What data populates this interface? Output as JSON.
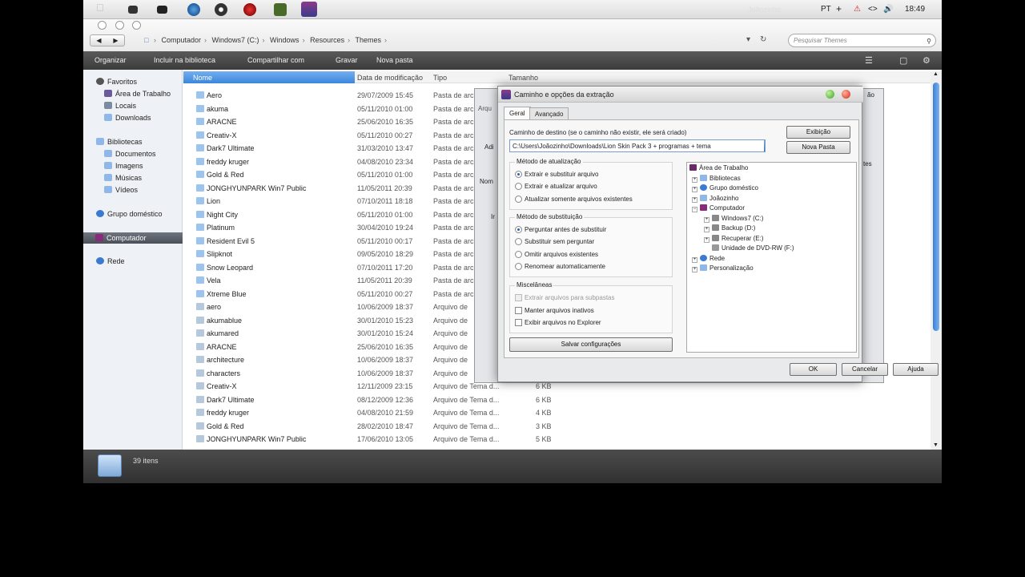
{
  "taskbar": {
    "user": "Joãozinho",
    "lang": "PT",
    "clock": "18:49"
  },
  "nav": {
    "breadcrumbs": [
      "Computador",
      "Windows7 (C:)",
      "Windows",
      "Resources",
      "Themes"
    ],
    "search_placeholder": "Pesquisar Themes"
  },
  "toolbar": {
    "organizar": "Organizar",
    "incluir": "Incluir na biblioteca",
    "compartilhar": "Compartilhar com",
    "gravar": "Gravar",
    "nova_pasta": "Nova pasta"
  },
  "sidebar": {
    "favoritos": "Favoritos",
    "area_trabalho": "Área de Trabalho",
    "locais": "Locais",
    "downloads": "Downloads",
    "bibliotecas": "Bibliotecas",
    "documentos": "Documentos",
    "imagens": "Imagens",
    "musicas": "Músicas",
    "videos": "Vídeos",
    "grupo": "Grupo doméstico",
    "computador": "Computador",
    "rede": "Rede"
  },
  "columns": {
    "nome": "Nome",
    "data": "Data de modificação",
    "tipo": "Tipo",
    "tamanho": "Tamanho"
  },
  "files": [
    {
      "name": "Aero",
      "date": "29/07/2009 15:45",
      "type": "Pasta de arc",
      "size": ""
    },
    {
      "name": "akuma",
      "date": "05/11/2010 01:00",
      "type": "Pasta de arc",
      "size": ""
    },
    {
      "name": "ARACNE",
      "date": "25/06/2010 16:35",
      "type": "Pasta de arc",
      "size": ""
    },
    {
      "name": "Creativ-X",
      "date": "05/11/2010 00:27",
      "type": "Pasta de arc",
      "size": ""
    },
    {
      "name": "Dark7 Ultimate",
      "date": "31/03/2010 13:47",
      "type": "Pasta de arc",
      "size": ""
    },
    {
      "name": "freddy kruger",
      "date": "04/08/2010 23:34",
      "type": "Pasta de arc",
      "size": ""
    },
    {
      "name": "Gold & Red",
      "date": "05/11/2010 01:00",
      "type": "Pasta de arc",
      "size": ""
    },
    {
      "name": "JONGHYUNPARK Win7 Public",
      "date": "11/05/2011 20:39",
      "type": "Pasta de arc",
      "size": ""
    },
    {
      "name": "Lion",
      "date": "07/10/2011 18:18",
      "type": "Pasta de arc",
      "size": ""
    },
    {
      "name": "Night City",
      "date": "05/11/2010 01:00",
      "type": "Pasta de arc",
      "size": ""
    },
    {
      "name": "Platinum",
      "date": "30/04/2010 19:24",
      "type": "Pasta de arc",
      "size": ""
    },
    {
      "name": "Resident Evil 5",
      "date": "05/11/2010 00:17",
      "type": "Pasta de arc",
      "size": ""
    },
    {
      "name": "Slipknot",
      "date": "09/05/2010 18:29",
      "type": "Pasta de arc",
      "size": ""
    },
    {
      "name": "Snow Leopard",
      "date": "07/10/2011 17:20",
      "type": "Pasta de arc",
      "size": ""
    },
    {
      "name": "Vela",
      "date": "11/05/2011 20:39",
      "type": "Pasta de arc",
      "size": ""
    },
    {
      "name": "Xtreme Blue",
      "date": "05/11/2010 00:27",
      "type": "Pasta de arc",
      "size": ""
    },
    {
      "name": "aero",
      "date": "10/06/2009 18:37",
      "type": "Arquivo de",
      "size": ""
    },
    {
      "name": "akumablue",
      "date": "30/01/2010 15:23",
      "type": "Arquivo de",
      "size": ""
    },
    {
      "name": "akumared",
      "date": "30/01/2010 15:24",
      "type": "Arquivo de",
      "size": ""
    },
    {
      "name": "ARACNE",
      "date": "25/06/2010 16:35",
      "type": "Arquivo de",
      "size": ""
    },
    {
      "name": "architecture",
      "date": "10/06/2009 18:37",
      "type": "Arquivo de",
      "size": ""
    },
    {
      "name": "characters",
      "date": "10/06/2009 18:37",
      "type": "Arquivo de",
      "size": ""
    },
    {
      "name": "Creativ-X",
      "date": "12/11/2009 23:15",
      "type": "Arquivo de Tema d...",
      "size": "6 KB"
    },
    {
      "name": "Dark7 Ultimate",
      "date": "08/12/2009 12:36",
      "type": "Arquivo de Tema d...",
      "size": "6 KB"
    },
    {
      "name": "freddy kruger",
      "date": "04/08/2010 21:59",
      "type": "Arquivo de Tema d...",
      "size": "4 KB"
    },
    {
      "name": "Gold & Red",
      "date": "28/02/2010 18:47",
      "type": "Arquivo de Tema d...",
      "size": "3 KB"
    },
    {
      "name": "JONGHYUNPARK Win7 Public",
      "date": "17/06/2010 13:05",
      "type": "Arquivo de Tema d...",
      "size": "5 KB"
    }
  ],
  "status": {
    "count": "39 itens"
  },
  "dialog": {
    "title": "Caminho e opções da extração",
    "tab_geral": "Geral",
    "tab_avancado": "Avançado",
    "dest_label": "Caminho de destino (se o caminho não existir, ele será criado)",
    "dest_value": "C:\\Users\\Joãozinho\\Downloads\\Lion Skin Pack 3 + programas + tema",
    "btn_exibicao": "Exibição",
    "btn_nova_pasta": "Nova Pasta",
    "update_title": "Método de atualização",
    "update_opts": [
      "Extrair e substituir arquivo",
      "Extrair e atualizar arquivo",
      "Atualizar somente arquivos existentes"
    ],
    "replace_title": "Método de substituição",
    "replace_opts": [
      "Perguntar antes de substituir",
      "Substituir sem perguntar",
      "Omitir arquivos existentes",
      "Renomear automaticamente"
    ],
    "misc_title": "Miscelâneas",
    "misc_opts": [
      "Extrair arquivos para subpastas",
      "Manter arquivos inativos",
      "Exibir arquivos no Explorer"
    ],
    "save_btn": "Salvar configurações",
    "tree": [
      "Área de Trabalho",
      "Bibliotecas",
      "Grupo doméstico",
      "Joãozinho",
      "Computador",
      "Windows7 (C:)",
      "Backup (D:)",
      "Recuperar (E:)",
      "Unidade de DVD-RW (F:)",
      "Rede",
      "Personalização"
    ],
    "ok": "OK",
    "cancel": "Cancelar",
    "help": "Ajuda"
  },
  "behind": {
    "arq": "Arqu",
    "adi": "Adi",
    "nom": "Nom",
    "ir": "Ir",
    "ao": "ão",
    "tes": "tes"
  },
  "colors": {
    "accent": "#3b86db",
    "toolbar": "#4a4a4a",
    "selected": "#555b66"
  }
}
